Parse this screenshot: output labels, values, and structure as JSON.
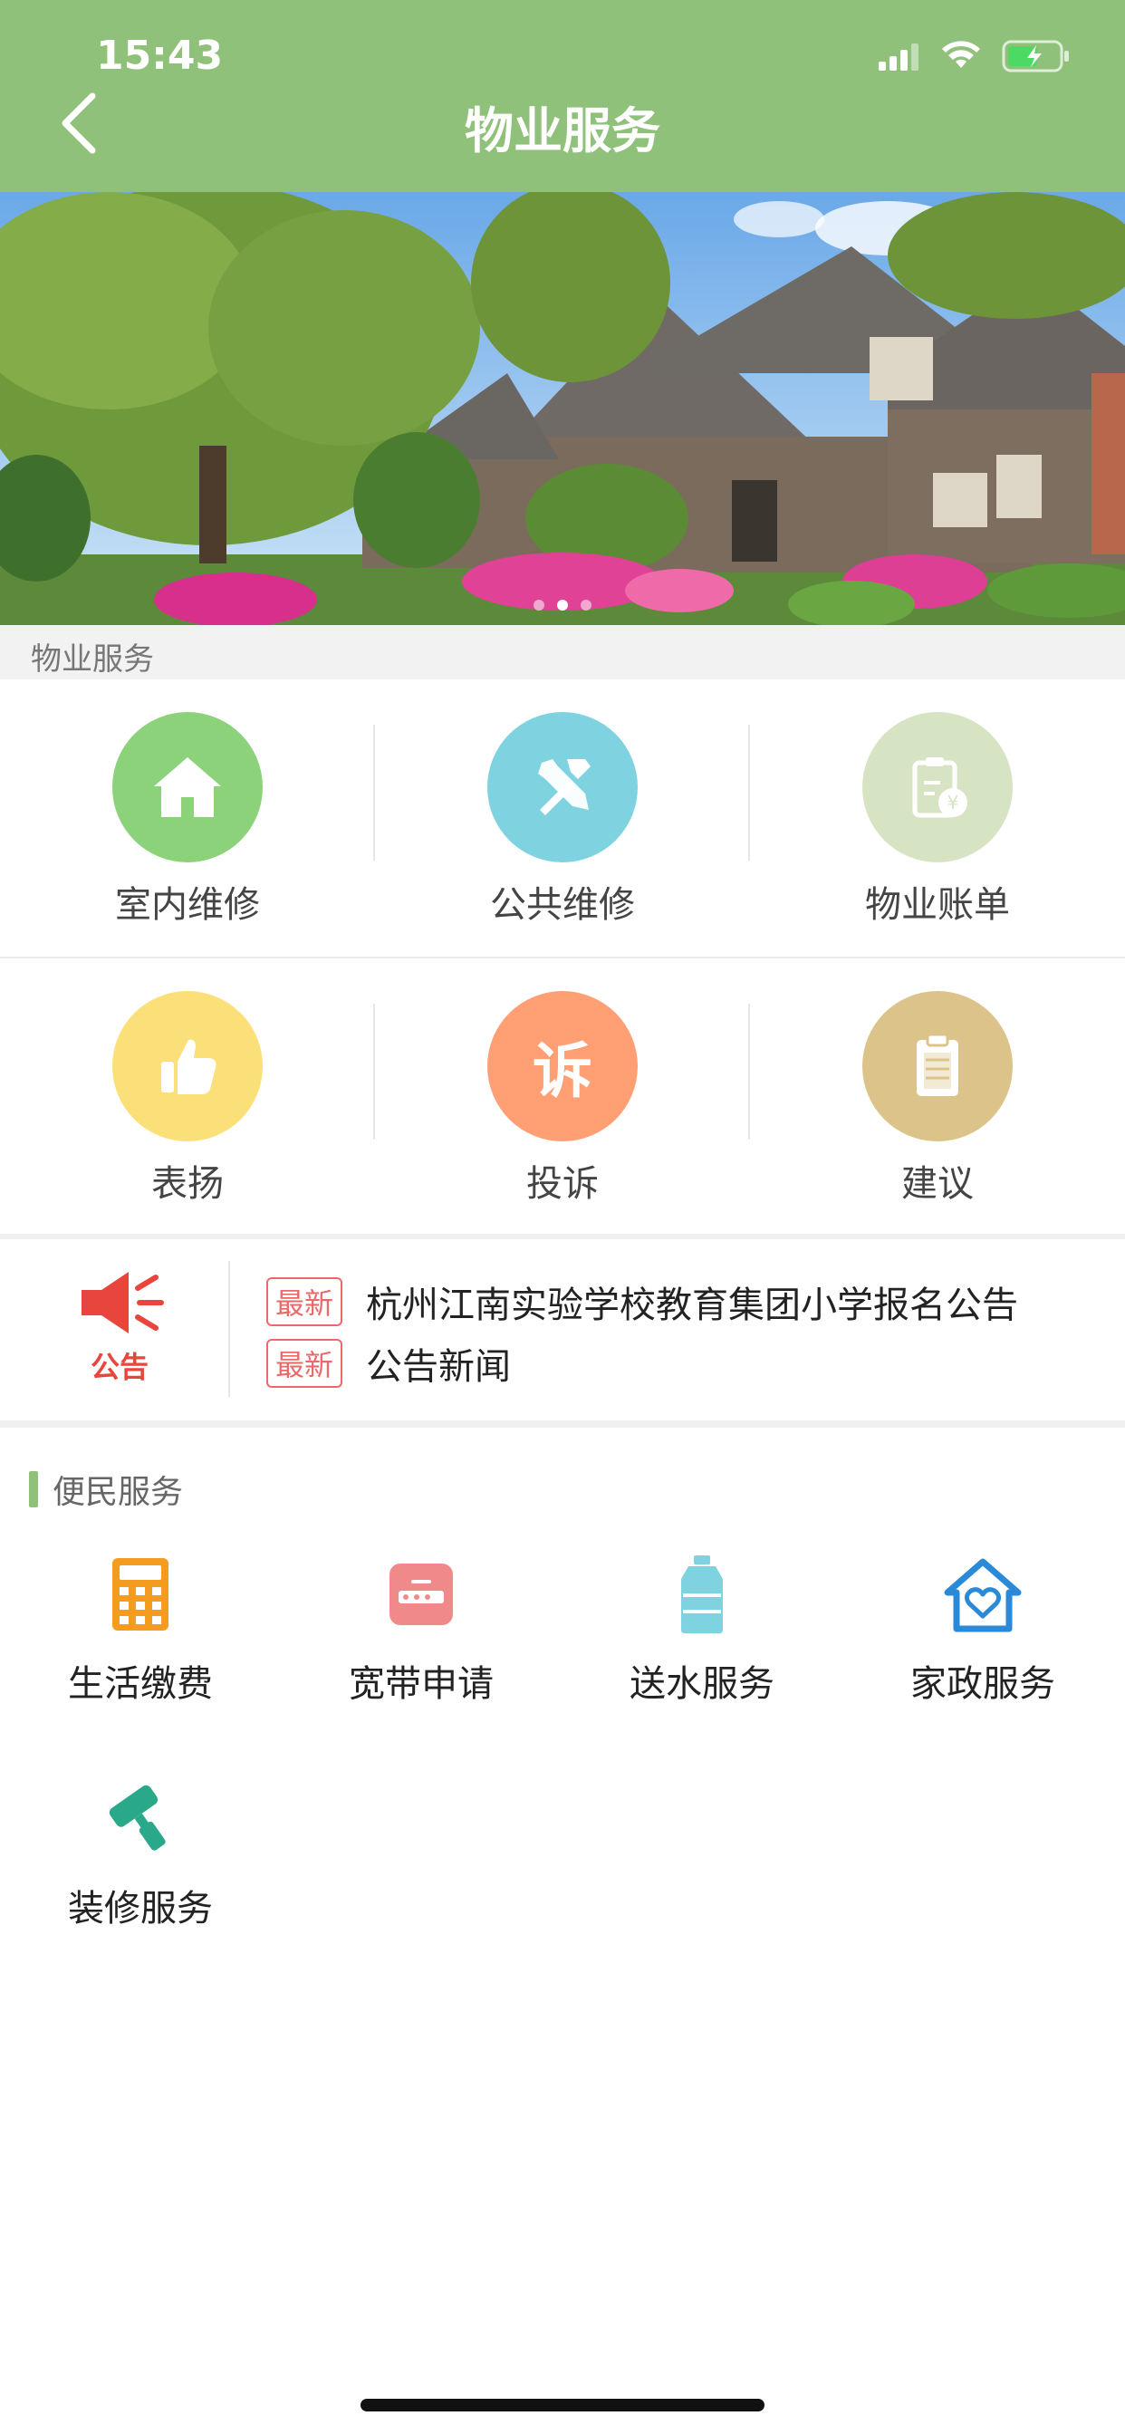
{
  "status": {
    "time": "15:43"
  },
  "nav": {
    "title": "物业服务"
  },
  "section": {
    "title": "物业服务"
  },
  "grid": [
    {
      "label": "室内维修",
      "icon": "home-icon",
      "color": "#8bd27a"
    },
    {
      "label": "公共维修",
      "icon": "tools-icon",
      "color": "#7fd3e0"
    },
    {
      "label": "物业账单",
      "icon": "bill-icon",
      "color": "#d6e4c4"
    },
    {
      "label": "表扬",
      "icon": "thumbs-up-icon",
      "color": "#fbe07a"
    },
    {
      "label": "投诉",
      "icon_text": "诉",
      "icon": "complaint-icon",
      "color": "#ff9f73"
    },
    {
      "label": "建议",
      "icon": "clipboard-icon",
      "color": "#dcc38a"
    }
  ],
  "notice": {
    "icon_label": "公告",
    "items": [
      {
        "badge": "最新",
        "text": "杭州江南实验学校教育集团小学报名公告"
      },
      {
        "badge": "最新",
        "text": "公告新闻"
      }
    ]
  },
  "convenience": {
    "title": "便民服务",
    "items": [
      {
        "label": "生活缴费",
        "icon": "calculator-icon",
        "color": "#f39c1f"
      },
      {
        "label": "宽带申请",
        "icon": "router-icon",
        "color": "#f08a8a"
      },
      {
        "label": "送水服务",
        "icon": "water-bottle-icon",
        "color": "#7fd3e0"
      },
      {
        "label": "家政服务",
        "icon": "house-heart-icon",
        "color": "#2b8ad8"
      },
      {
        "label": "装修服务",
        "icon": "paint-roller-icon",
        "color": "#2aa88a"
      }
    ]
  },
  "banner": {
    "slides": 3,
    "active": 1
  }
}
